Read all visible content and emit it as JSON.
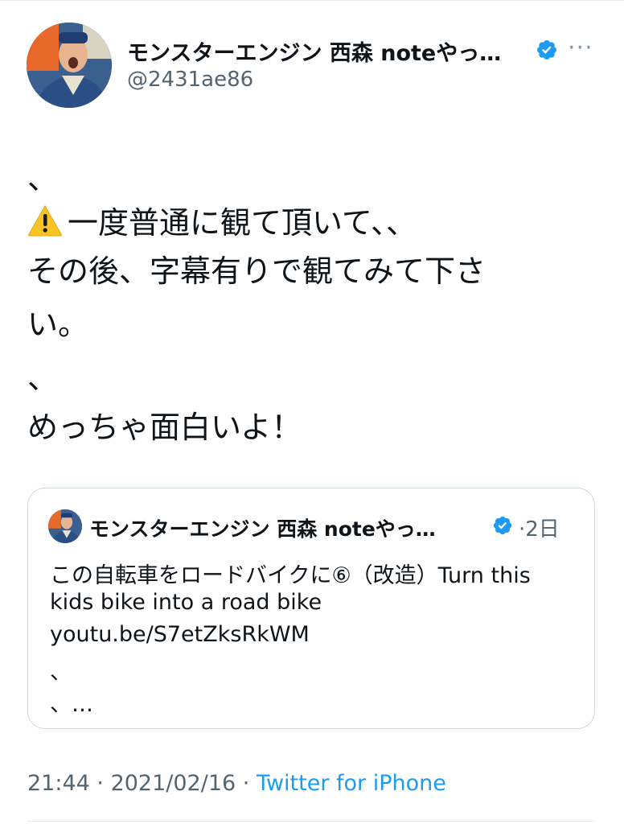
{
  "tweet": {
    "author_name": "モンスターエンジン 西森 noteやっ…",
    "handle": "@2431ae86",
    "more_label": "···",
    "lines": [
      "、",
      "一度普通に観て頂いて、、",
      "その後、字幕有りで観てみて下さ",
      "い。",
      "、",
      "めっちゃ面白いよ！"
    ],
    "warning_emoji": "warning-icon"
  },
  "quote": {
    "author_name": "モンスターエンジン 西森 noteやっ…",
    "date": "·2日",
    "lines": [
      "この自転車をロードバイクに⑥（改造）Turn this",
      "kids bike into a road bike",
      "youtu.be/S7etZksRkWM",
      "、",
      "、…"
    ]
  },
  "meta": {
    "time": "21:44",
    "sep1": " · ",
    "date": "2021/02/16",
    "sep2": " · ",
    "source": "Twitter for iPhone"
  },
  "colors": {
    "accent": "#1d9bf0",
    "secondary_text": "#536471",
    "border": "#cfd9de"
  }
}
